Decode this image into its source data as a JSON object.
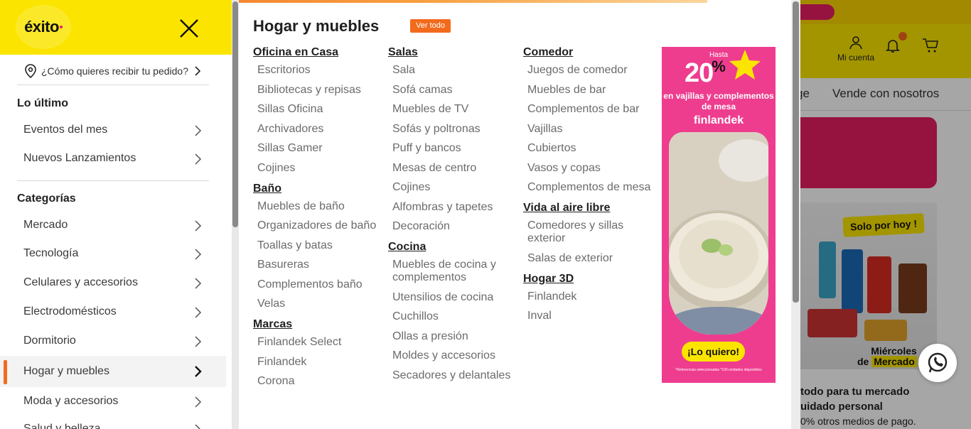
{
  "brand": {
    "logo_text": "éxito",
    "colors": {
      "yellow": "#fbe500",
      "orange": "#f26b1d",
      "pink": "#e61e63"
    }
  },
  "sidebar": {
    "delivery_label": "¿Cómo quieres recibir tu pedido?",
    "latest": {
      "title": "Lo último",
      "items": [
        {
          "label": "Eventos del mes"
        },
        {
          "label": "Nuevos Lanzamientos"
        }
      ]
    },
    "categories": {
      "title": "Categorías",
      "items": [
        {
          "label": "Mercado"
        },
        {
          "label": "Tecnología"
        },
        {
          "label": "Celulares y accesorios"
        },
        {
          "label": "Electrodomésticos"
        },
        {
          "label": "Dormitorio"
        },
        {
          "label": "Hogar y muebles",
          "active": true
        },
        {
          "label": "Moda y accesorios"
        },
        {
          "label": "Salud y belleza"
        }
      ]
    }
  },
  "menu": {
    "title": "Hogar y muebles",
    "see_all": "Ver todo",
    "columns": [
      {
        "groups": [
          {
            "title": "Oficina en Casa",
            "items": [
              "Escritorios",
              "Bibliotecas y repisas",
              "Sillas Oficina",
              "Archivadores",
              "Sillas Gamer",
              "Cojines"
            ]
          },
          {
            "title": "Baño",
            "items": [
              "Muebles de baño",
              "Organizadores de baño",
              "Toallas y batas",
              "Basureras",
              "Complementos baño",
              "Velas"
            ]
          },
          {
            "title": "Marcas",
            "items": [
              "Finlandek Select",
              "Finlandek",
              "Corona"
            ]
          }
        ]
      },
      {
        "groups": [
          {
            "title": "Salas",
            "items": [
              "Sala",
              "Sofá camas",
              "Muebles de TV",
              "Sofás y poltronas",
              "Puff y bancos",
              "Mesas de centro",
              "Cojines",
              "Alfombras y tapetes",
              "Decoración"
            ]
          },
          {
            "title": "Cocina",
            "items": [
              "Muebles de cocina y complementos",
              "Utensilios de cocina",
              "Cuchillos",
              "Ollas a presión",
              "Moldes y accesorios",
              "Secadores y delantales"
            ]
          }
        ]
      },
      {
        "groups": [
          {
            "title": "Comedor",
            "items": [
              "Juegos de comedor",
              "Muebles de bar",
              "Complementos de bar",
              "Vajillas",
              "Cubiertos",
              "Vasos y copas",
              "Complementos de mesa"
            ]
          },
          {
            "title": "Vida al aire libre",
            "items": [
              "Comedores y sillas exterior",
              "Salas de exterior"
            ]
          },
          {
            "title": "Hogar 3D",
            "items": [
              "Finlandek",
              "Inval"
            ]
          }
        ]
      }
    ]
  },
  "ad": {
    "hasta": "Hasta",
    "discount": "20",
    "percent": "%",
    "subtitle": "en vajillas y complementos de mesa",
    "brand": "finlandek",
    "cta": "¡Lo quiero!",
    "fine_print": "*Referencias seleccionadas *100 unidades disponibles"
  },
  "background_page": {
    "account_label": "Mi cuenta",
    "nav_partial": "ge",
    "nav_sell": "Vende con nosotros",
    "promo_tag": "Solo por hoy !",
    "promo_day_1": "Miércoles",
    "promo_day_2_pre": "de ",
    "promo_day_2": "Mercado",
    "footer_line1": "todo para tu mercado",
    "footer_line2": "uidado personal",
    "footer_line3": "0% otros medios de pago."
  }
}
